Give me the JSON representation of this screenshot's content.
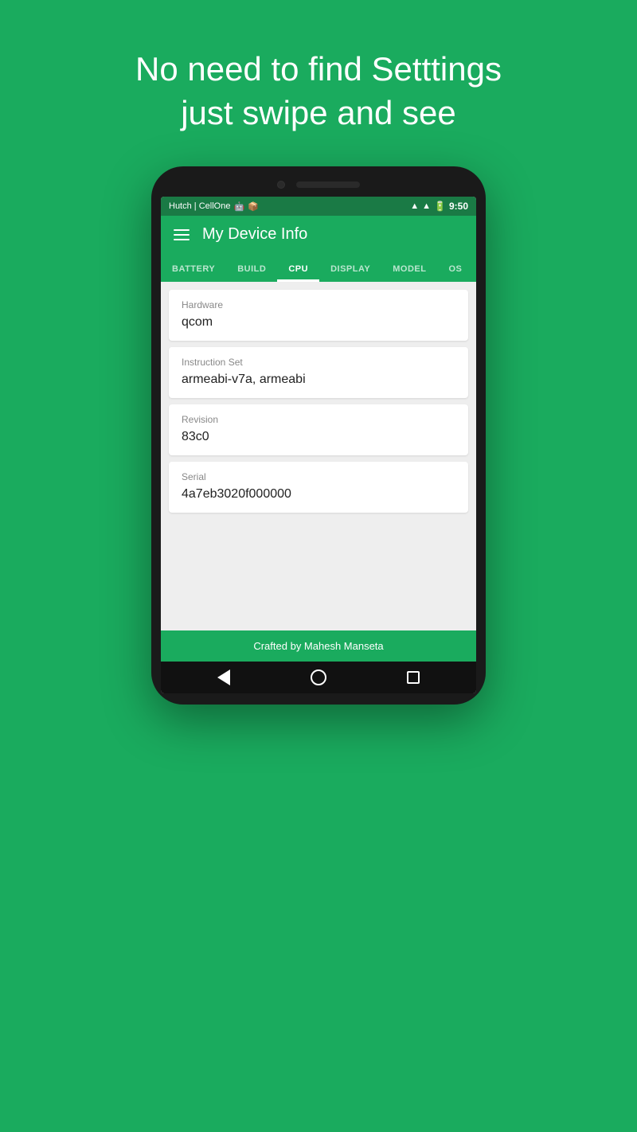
{
  "background_color": "#1aab5e",
  "hero": {
    "line1": "No need to find Setttings",
    "line2": "just swipe and see"
  },
  "phone": {
    "status_bar": {
      "carrier": "Hutch | CellOne",
      "icons": "🤖 📦",
      "signal1": "▲",
      "signal2": "▲",
      "battery": "🔋",
      "time": "9:50"
    },
    "app_bar": {
      "title": "My Device Info"
    },
    "tabs": [
      {
        "label": "BATTERY",
        "active": false
      },
      {
        "label": "BUILD",
        "active": false
      },
      {
        "label": "CPU",
        "active": true
      },
      {
        "label": "DISPLAY",
        "active": false
      },
      {
        "label": "MODEL",
        "active": false
      },
      {
        "label": "OS",
        "active": false
      }
    ],
    "info_cards": [
      {
        "label": "Hardware",
        "value": "qcom"
      },
      {
        "label": "Instruction Set",
        "value": "armeabi-v7a, armeabi"
      },
      {
        "label": "Revision",
        "value": "83c0"
      },
      {
        "label": "Serial",
        "value": "4a7eb3020f000000"
      }
    ],
    "footer": {
      "text": "Crafted by Mahesh Manseta"
    }
  }
}
